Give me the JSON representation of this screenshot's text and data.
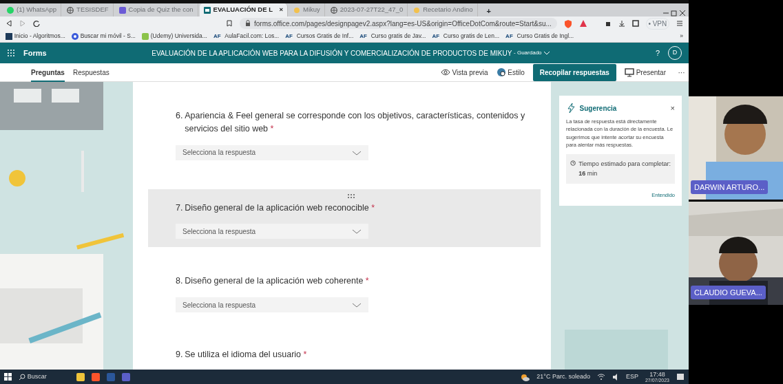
{
  "browser": {
    "tabs": [
      {
        "label": "(1) WhatsApp",
        "selected": false
      },
      {
        "label": "TESISDEF",
        "selected": false
      },
      {
        "label": "Copia de Quiz the con",
        "selected": false
      },
      {
        "label": "EVALUACIÓN DE L",
        "selected": true,
        "close": "×"
      },
      {
        "label": "Mikuy",
        "selected": false
      },
      {
        "label": "2023-07-27T22_47_0",
        "selected": false
      },
      {
        "label": "Recetario Andino",
        "selected": false
      }
    ],
    "new_tab": "+",
    "address": "forms.office.com/pages/designpagev2.aspx?lang=es-US&origin=OfficeDotCom&route=Start&su...",
    "vpn": "• VPN",
    "bookmarks": [
      {
        "label": "Inicio - Algoritmos..."
      },
      {
        "label": "Buscar mi móvil - S..."
      },
      {
        "label": "(Udemy) Universida..."
      },
      {
        "label": "AulaFacil.com: Los...",
        "badge": "AF"
      },
      {
        "label": "Cursos Gratis de Inf...",
        "badge": "AF"
      },
      {
        "label": "Curso gratis de Jav...",
        "badge": "AF"
      },
      {
        "label": "Curso gratis de Len...",
        "badge": "AF"
      },
      {
        "label": "Curso Gratis de Ingl...",
        "badge": "AF"
      }
    ],
    "more_bookmarks": "»"
  },
  "forms": {
    "app": "Forms",
    "title": "EVALUACIÓN DE LA APLICACIÓN WEB PARA LA DIFUSIÓN Y COMERCIALIZACIÓN DE PRODUCTOS DE MIKUY",
    "status": "- Guardado",
    "help": "?",
    "avatar": "D",
    "tabs": [
      {
        "label": "Preguntas",
        "selected": true
      },
      {
        "label": "Respuestas",
        "selected": false
      }
    ],
    "actions": [
      {
        "label": "Vista previa",
        "kind": "link"
      },
      {
        "label": "Estilo",
        "kind": "link"
      },
      {
        "label": "Recopilar respuestas",
        "kind": "primary"
      },
      {
        "label": "Presentar",
        "kind": "link"
      },
      {
        "label": "···",
        "kind": "more"
      }
    ],
    "questions": [
      {
        "number": "6.",
        "text": "Apariencia & Feel general se corresponde con los objetivos, características, contenidos y servicios del sitio web",
        "required": true,
        "placeholder": "Selecciona la respuesta",
        "selected": false
      },
      {
        "number": "7.",
        "text": "Diseño general de la aplicación web reconocible",
        "required": true,
        "placeholder": "Selecciona la respuesta",
        "selected": true
      },
      {
        "number": "8.",
        "text": "Diseño general de la aplicación web coherente",
        "required": true,
        "placeholder": "Selecciona la respuesta",
        "selected": false
      },
      {
        "number": "9.",
        "text": "Se utiliza el idioma del usuario",
        "required": true
      }
    ],
    "required_mark": "*",
    "suggestion": {
      "title": "Sugerencia",
      "close": "×",
      "body": "La tasa de respuesta está directamente relacionada con la duración de la encuesta. Le sugerimos que intente acortar su encuesta para alentar más respuestas.",
      "estimate": "Tiempo estimado para completar: **16** min",
      "action": "Entendido"
    }
  },
  "video": [
    {
      "name": "DARWIN ARTURO..."
    },
    {
      "name": "CLAUDIO GUEVA..."
    }
  ],
  "taskbar": {
    "search": "Buscar",
    "weather": "21°C  Parc. soleado",
    "language": "ESP",
    "time": "17:48",
    "date": "27/07/2023"
  }
}
